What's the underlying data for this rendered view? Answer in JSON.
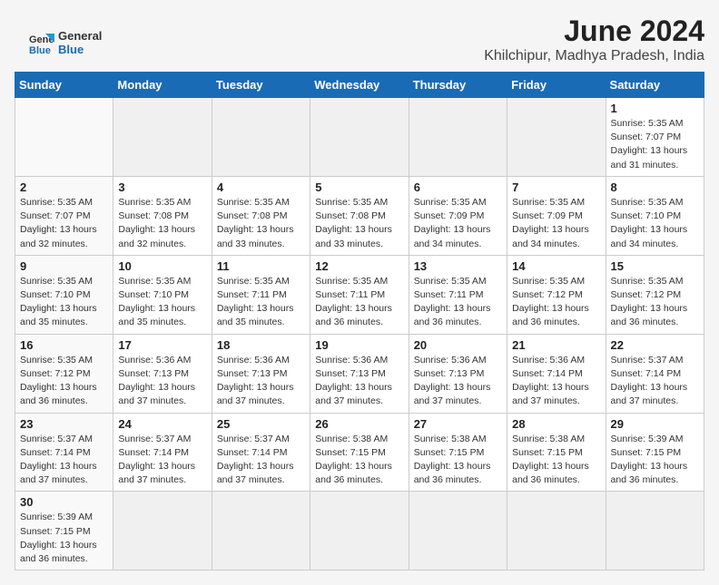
{
  "logo": {
    "line1": "General",
    "line2": "Blue"
  },
  "title": "June 2024",
  "subtitle": "Khilchipur, Madhya Pradesh, India",
  "days_of_week": [
    "Sunday",
    "Monday",
    "Tuesday",
    "Wednesday",
    "Thursday",
    "Friday",
    "Saturday"
  ],
  "weeks": [
    [
      {
        "day": "",
        "info": ""
      },
      {
        "day": "",
        "info": ""
      },
      {
        "day": "",
        "info": ""
      },
      {
        "day": "",
        "info": ""
      },
      {
        "day": "",
        "info": ""
      },
      {
        "day": "",
        "info": ""
      },
      {
        "day": "1",
        "info": "Sunrise: 5:35 AM\nSunset: 7:07 PM\nDaylight: 13 hours and 31 minutes."
      }
    ],
    [
      {
        "day": "2",
        "info": "Sunrise: 5:35 AM\nSunset: 7:07 PM\nDaylight: 13 hours and 32 minutes."
      },
      {
        "day": "3",
        "info": "Sunrise: 5:35 AM\nSunset: 7:08 PM\nDaylight: 13 hours and 32 minutes."
      },
      {
        "day": "4",
        "info": "Sunrise: 5:35 AM\nSunset: 7:08 PM\nDaylight: 13 hours and 33 minutes."
      },
      {
        "day": "5",
        "info": "Sunrise: 5:35 AM\nSunset: 7:08 PM\nDaylight: 13 hours and 33 minutes."
      },
      {
        "day": "6",
        "info": "Sunrise: 5:35 AM\nSunset: 7:09 PM\nDaylight: 13 hours and 34 minutes."
      },
      {
        "day": "7",
        "info": "Sunrise: 5:35 AM\nSunset: 7:09 PM\nDaylight: 13 hours and 34 minutes."
      },
      {
        "day": "8",
        "info": "Sunrise: 5:35 AM\nSunset: 7:10 PM\nDaylight: 13 hours and 34 minutes."
      }
    ],
    [
      {
        "day": "9",
        "info": "Sunrise: 5:35 AM\nSunset: 7:10 PM\nDaylight: 13 hours and 35 minutes."
      },
      {
        "day": "10",
        "info": "Sunrise: 5:35 AM\nSunset: 7:10 PM\nDaylight: 13 hours and 35 minutes."
      },
      {
        "day": "11",
        "info": "Sunrise: 5:35 AM\nSunset: 7:11 PM\nDaylight: 13 hours and 35 minutes."
      },
      {
        "day": "12",
        "info": "Sunrise: 5:35 AM\nSunset: 7:11 PM\nDaylight: 13 hours and 36 minutes."
      },
      {
        "day": "13",
        "info": "Sunrise: 5:35 AM\nSunset: 7:11 PM\nDaylight: 13 hours and 36 minutes."
      },
      {
        "day": "14",
        "info": "Sunrise: 5:35 AM\nSunset: 7:12 PM\nDaylight: 13 hours and 36 minutes."
      },
      {
        "day": "15",
        "info": "Sunrise: 5:35 AM\nSunset: 7:12 PM\nDaylight: 13 hours and 36 minutes."
      }
    ],
    [
      {
        "day": "16",
        "info": "Sunrise: 5:35 AM\nSunset: 7:12 PM\nDaylight: 13 hours and 36 minutes."
      },
      {
        "day": "17",
        "info": "Sunrise: 5:36 AM\nSunset: 7:13 PM\nDaylight: 13 hours and 37 minutes."
      },
      {
        "day": "18",
        "info": "Sunrise: 5:36 AM\nSunset: 7:13 PM\nDaylight: 13 hours and 37 minutes."
      },
      {
        "day": "19",
        "info": "Sunrise: 5:36 AM\nSunset: 7:13 PM\nDaylight: 13 hours and 37 minutes."
      },
      {
        "day": "20",
        "info": "Sunrise: 5:36 AM\nSunset: 7:13 PM\nDaylight: 13 hours and 37 minutes."
      },
      {
        "day": "21",
        "info": "Sunrise: 5:36 AM\nSunset: 7:14 PM\nDaylight: 13 hours and 37 minutes."
      },
      {
        "day": "22",
        "info": "Sunrise: 5:37 AM\nSunset: 7:14 PM\nDaylight: 13 hours and 37 minutes."
      }
    ],
    [
      {
        "day": "23",
        "info": "Sunrise: 5:37 AM\nSunset: 7:14 PM\nDaylight: 13 hours and 37 minutes."
      },
      {
        "day": "24",
        "info": "Sunrise: 5:37 AM\nSunset: 7:14 PM\nDaylight: 13 hours and 37 minutes."
      },
      {
        "day": "25",
        "info": "Sunrise: 5:37 AM\nSunset: 7:14 PM\nDaylight: 13 hours and 37 minutes."
      },
      {
        "day": "26",
        "info": "Sunrise: 5:38 AM\nSunset: 7:15 PM\nDaylight: 13 hours and 36 minutes."
      },
      {
        "day": "27",
        "info": "Sunrise: 5:38 AM\nSunset: 7:15 PM\nDaylight: 13 hours and 36 minutes."
      },
      {
        "day": "28",
        "info": "Sunrise: 5:38 AM\nSunset: 7:15 PM\nDaylight: 13 hours and 36 minutes."
      },
      {
        "day": "29",
        "info": "Sunrise: 5:39 AM\nSunset: 7:15 PM\nDaylight: 13 hours and 36 minutes."
      }
    ],
    [
      {
        "day": "30",
        "info": "Sunrise: 5:39 AM\nSunset: 7:15 PM\nDaylight: 13 hours and 36 minutes."
      },
      {
        "day": "",
        "info": ""
      },
      {
        "day": "",
        "info": ""
      },
      {
        "day": "",
        "info": ""
      },
      {
        "day": "",
        "info": ""
      },
      {
        "day": "",
        "info": ""
      },
      {
        "day": "",
        "info": ""
      }
    ]
  ]
}
